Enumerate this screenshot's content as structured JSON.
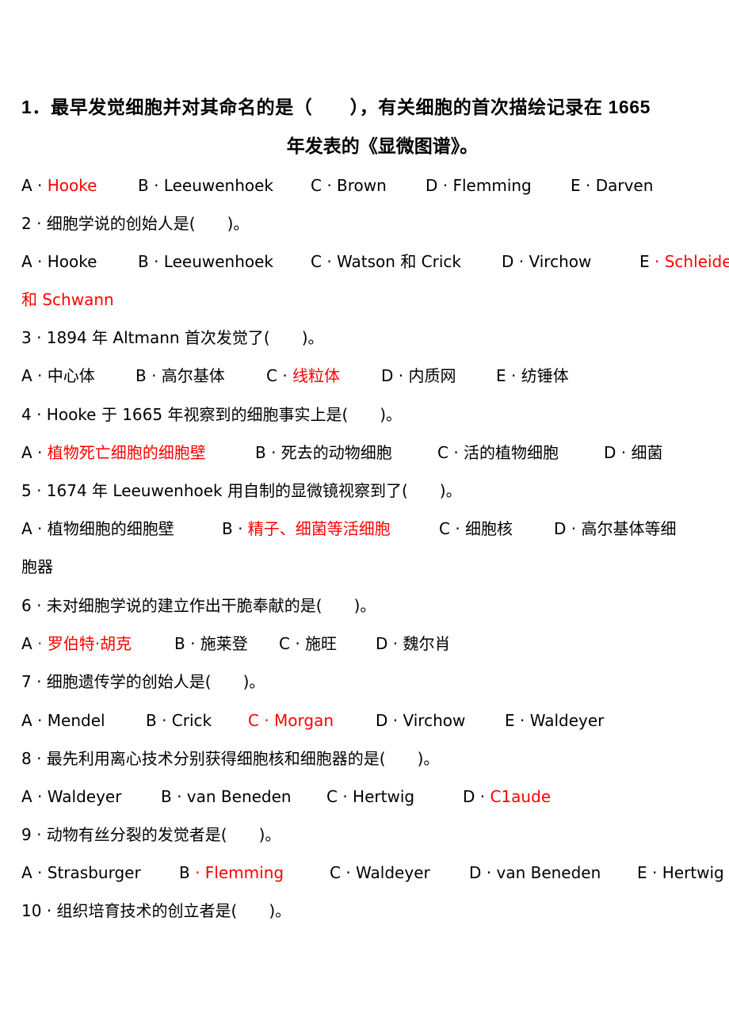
{
  "document": {
    "highlight_color": "#ff0000",
    "questions": [
      {
        "number": "1",
        "stem_line1": "1．最早发觉细胞并对其命名的是（　　），有关细胞的首次描绘记录在 1665",
        "stem_line2": "年发表的《显微图谱》。",
        "options": [
          {
            "prefix": "A · ",
            "text": "Hooke",
            "correct": true
          },
          {
            "prefix": "B · ",
            "text": "Leeuwenhoek"
          },
          {
            "prefix": "C · ",
            "text": "Brown"
          },
          {
            "prefix": "D · ",
            "text": "Flemming"
          },
          {
            "prefix": "E · ",
            "text": "Darven"
          }
        ]
      },
      {
        "number": "2",
        "stem": "2 · 细胞学说的创始人是(　　)。",
        "options": [
          {
            "prefix": "A · ",
            "text": "Hooke"
          },
          {
            "prefix": "B · ",
            "text": "Leeuwenhoek"
          },
          {
            "prefix": "C · ",
            "text": "Watson 和 Crick"
          },
          {
            "prefix": "D · ",
            "text": "Virchow"
          },
          {
            "prefix": "E",
            "text": " · Schleiden",
            "correct": true
          }
        ],
        "continuation": "和 Schwann"
      },
      {
        "number": "3",
        "stem": "3 · 1894 年 Altmann 首次发觉了(　　)。",
        "options": [
          {
            "prefix": "A · ",
            "text": "中心体"
          },
          {
            "prefix": "B · ",
            "text": "高尔基体"
          },
          {
            "prefix": "C · ",
            "text": "线粒体",
            "correct": true
          },
          {
            "prefix": "D · ",
            "text": "内质网"
          },
          {
            "prefix": "E · ",
            "text": "纺锤体"
          }
        ]
      },
      {
        "number": "4",
        "stem": "4 · Hooke 于 1665 年视察到的细胞事实上是(　　)。",
        "options": [
          {
            "prefix": "A · ",
            "text": "植物死亡细胞的细胞壁",
            "correct": true
          },
          {
            "prefix": "B · ",
            "text": "死去的动物细胞"
          },
          {
            "prefix": "C · ",
            "text": "活的植物细胞"
          },
          {
            "prefix": "D · ",
            "text": "细菌"
          }
        ]
      },
      {
        "number": "5",
        "stem": "5 · 1674 年 Leeuwenhoek 用自制的显微镜视察到了(　　)。",
        "options": [
          {
            "prefix": "A · ",
            "text": "植物细胞的细胞壁"
          },
          {
            "prefix": "B · ",
            "text": "精子、细菌等活细胞",
            "correct": true
          },
          {
            "prefix": "C · ",
            "text": "细胞核"
          },
          {
            "prefix": "D · ",
            "text": "高尔基体等细"
          }
        ],
        "continuation": "胞器"
      },
      {
        "number": "6",
        "stem": "6 · 未对细胞学说的建立作出干脆奉献的是(　　)。",
        "options": [
          {
            "prefix": "A",
            "text": " · 罗伯特·胡克",
            "correct": true
          },
          {
            "prefix": "B · ",
            "text": "施莱登"
          },
          {
            "prefix": "C · ",
            "text": "施旺"
          },
          {
            "prefix": "D · ",
            "text": "魏尔肖"
          }
        ]
      },
      {
        "number": "7",
        "stem": "7 · 细胞遗传学的创始人是(　　)。",
        "options": [
          {
            "prefix": "A · ",
            "text": "Mendel"
          },
          {
            "prefix": "B · ",
            "text": "Crick"
          },
          {
            "prefix": "",
            "text": "C · Morgan",
            "correct": true
          },
          {
            "prefix": "D · ",
            "text": "Virchow"
          },
          {
            "prefix": "E · ",
            "text": "Waldeyer"
          }
        ]
      },
      {
        "number": "8",
        "stem": "8 · 最先利用离心技术分别获得细胞核和细胞器的是(　　)。",
        "options": [
          {
            "prefix": "A · ",
            "text": "Waldeyer"
          },
          {
            "prefix": "B · ",
            "text": "van Beneden"
          },
          {
            "prefix": "C · ",
            "text": "Hertwig"
          },
          {
            "prefix": "D · ",
            "text": "C1aude",
            "correct": true
          }
        ]
      },
      {
        "number": "9",
        "stem": "9 · 动物有丝分裂的发觉者是(　　)。",
        "options": [
          {
            "prefix": "A · ",
            "text": "Strasburger"
          },
          {
            "prefix": "B",
            "text": " · Flemming",
            "correct": true
          },
          {
            "prefix": "C · ",
            "text": "Waldeyer"
          },
          {
            "prefix": "D · ",
            "text": "van Beneden"
          },
          {
            "prefix": "E · ",
            "text": "Hertwig"
          }
        ]
      },
      {
        "number": "10",
        "stem": "10 · 组织培育技术的创立者是(　　)。"
      }
    ]
  }
}
